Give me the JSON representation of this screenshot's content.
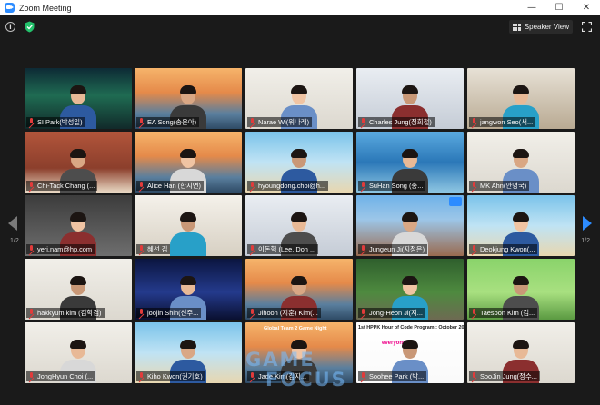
{
  "window": {
    "title": "Zoom Meeting",
    "controls": {
      "minimize": "—",
      "maximize": "☐",
      "close": "✕"
    }
  },
  "toolbar": {
    "info_icon": "info-icon",
    "security_icon": "shield-icon",
    "speaker_view_label": "Speaker View",
    "fullscreen_icon": "fullscreen-icon"
  },
  "pagination": {
    "left": "1/2",
    "right": "1/2"
  },
  "colors": {
    "accent": "#2d8cff",
    "active_speaker": "#c9d44a",
    "muted_mic": "#e23b3b",
    "shield": "#23c16b"
  },
  "participants": [
    {
      "name": "SI Park(박성일)",
      "bg": "aurora",
      "active": false
    },
    {
      "name": "EA Song(송은아)",
      "bg": "bridge",
      "active": true
    },
    {
      "name": "Narae Wi(위나래)",
      "bg": "room-white",
      "active": false
    },
    {
      "name": "Charles Jung(정회철)",
      "bg": "office-light",
      "active": false
    },
    {
      "name": "jangwon Seo(서...",
      "bg": "room-shelf",
      "active": false
    },
    {
      "name": "Chi-Tack Chang (...",
      "bg": "brick",
      "active": false
    },
    {
      "name": "Alice Han (한지연)",
      "bg": "bridge",
      "active": false
    },
    {
      "name": "hyoungdong.choi@h...",
      "bg": "beach",
      "active": false
    },
    {
      "name": "SuHan Song (송...",
      "bg": "resort",
      "active": false
    },
    {
      "name": "MK Ahn(안명국)",
      "bg": "room-white",
      "active": false
    },
    {
      "name": "yeri.nam@hp.com",
      "bg": "office-dark",
      "active": false
    },
    {
      "name": "혜선 김",
      "bg": "gallery",
      "active": false
    },
    {
      "name": "이돈혁 (Lee, Don ...",
      "bg": "office-light",
      "active": false
    },
    {
      "name": "Jungeun Ji(지정은)",
      "bg": "city",
      "active": false
    },
    {
      "name": "Deokjung Kwon(...",
      "bg": "beach",
      "active": false
    },
    {
      "name": "hakkyum kim (김학겸)",
      "bg": "room-white",
      "active": false
    },
    {
      "name": "joojin Shin(신주...",
      "bg": "space",
      "active": false
    },
    {
      "name": "Jihoon (지훈) Kim(...",
      "bg": "bridge",
      "active": false
    },
    {
      "name": "Jong-Heon Ji(지...",
      "bg": "garden",
      "active": false
    },
    {
      "name": "Taesoon Kim (김...",
      "bg": "grass",
      "active": false
    },
    {
      "name": "JongHyun Choi (...",
      "bg": "room-white",
      "active": false
    },
    {
      "name": "Kiho Kwon(권기호)",
      "bg": "beach",
      "active": false
    },
    {
      "name": "Jade Kim(김지...",
      "bg": "bridge",
      "active": false
    },
    {
      "name": "Soohee Park (박...",
      "bg": "slide",
      "active": false
    },
    {
      "name": "SooJin Jung(정수...",
      "bg": "room-white",
      "active": false
    }
  ],
  "overlays": {
    "hour_of_code_banner": "1st HPPK Hour of Code Program : October 20",
    "slide_text": "everyone",
    "team_banner": "Global Team 2 Game Night",
    "more_button": "..."
  },
  "watermark": {
    "top": "GAME",
    "bottom": "FOCUS"
  }
}
